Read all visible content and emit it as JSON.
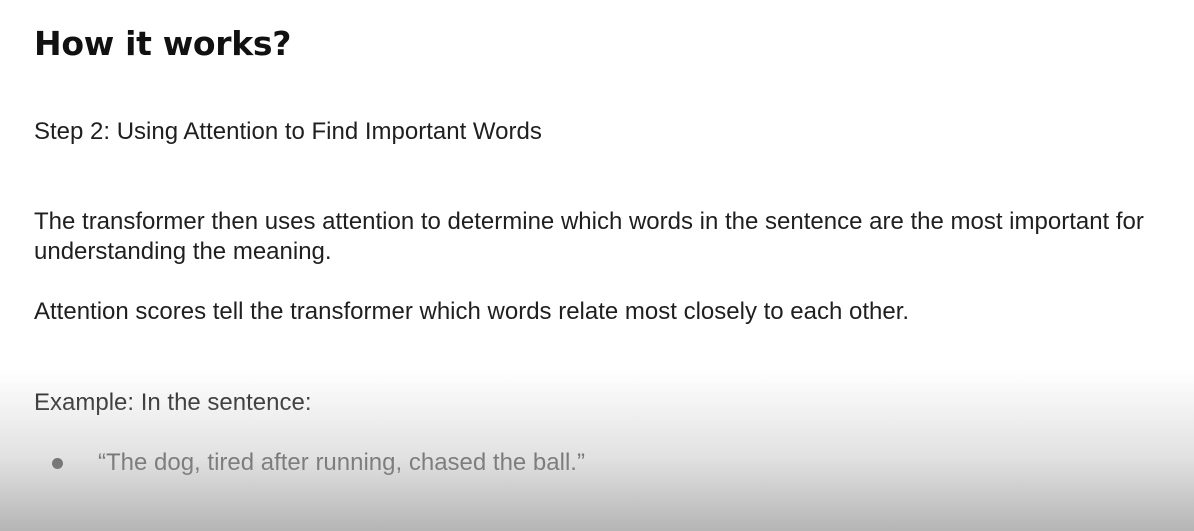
{
  "slide": {
    "title": "How it works?",
    "step": "Step 2: Using Attention to Find Important Words",
    "paragraph1": "The transformer then uses attention to determine which words in the sentence are the most important for understanding the meaning.",
    "paragraph2": "Attention scores tell the transformer which words relate most closely to each other.",
    "example_label": "Example: In the sentence:",
    "bullets": [
      "“The dog, tired after running, chased the ball.”"
    ]
  }
}
